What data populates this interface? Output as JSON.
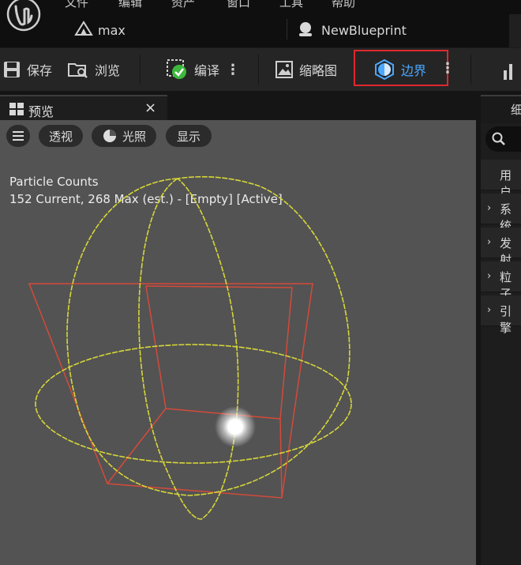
{
  "menu": {
    "items": [
      "文件",
      "编辑",
      "资产",
      "窗口",
      "工具",
      "帮助"
    ]
  },
  "tabs": [
    {
      "label": "max"
    },
    {
      "label": "NewBlueprint"
    }
  ],
  "toolbar": {
    "save": "保存",
    "browse": "浏览",
    "compile": "编译",
    "thumbnail": "缩略图",
    "bounds": "边界"
  },
  "preview": {
    "tab_label": "预览",
    "close_glyph": "×",
    "perspective": "透视",
    "lighting": "光照",
    "show": "显示",
    "stats_title": "Particle Counts",
    "stats_line": "152 Current, 268 Max (est.) - [Empty] [Active]"
  },
  "right_panel": {
    "header_char": "细",
    "items": [
      "用户",
      "系统",
      "发射",
      "粒子",
      "引擎"
    ]
  },
  "colors": {
    "highlight_border": "#e0282e",
    "bounds_text": "#4aa8ff",
    "sphere": "#d6d63a",
    "box": "#d44a3a"
  }
}
